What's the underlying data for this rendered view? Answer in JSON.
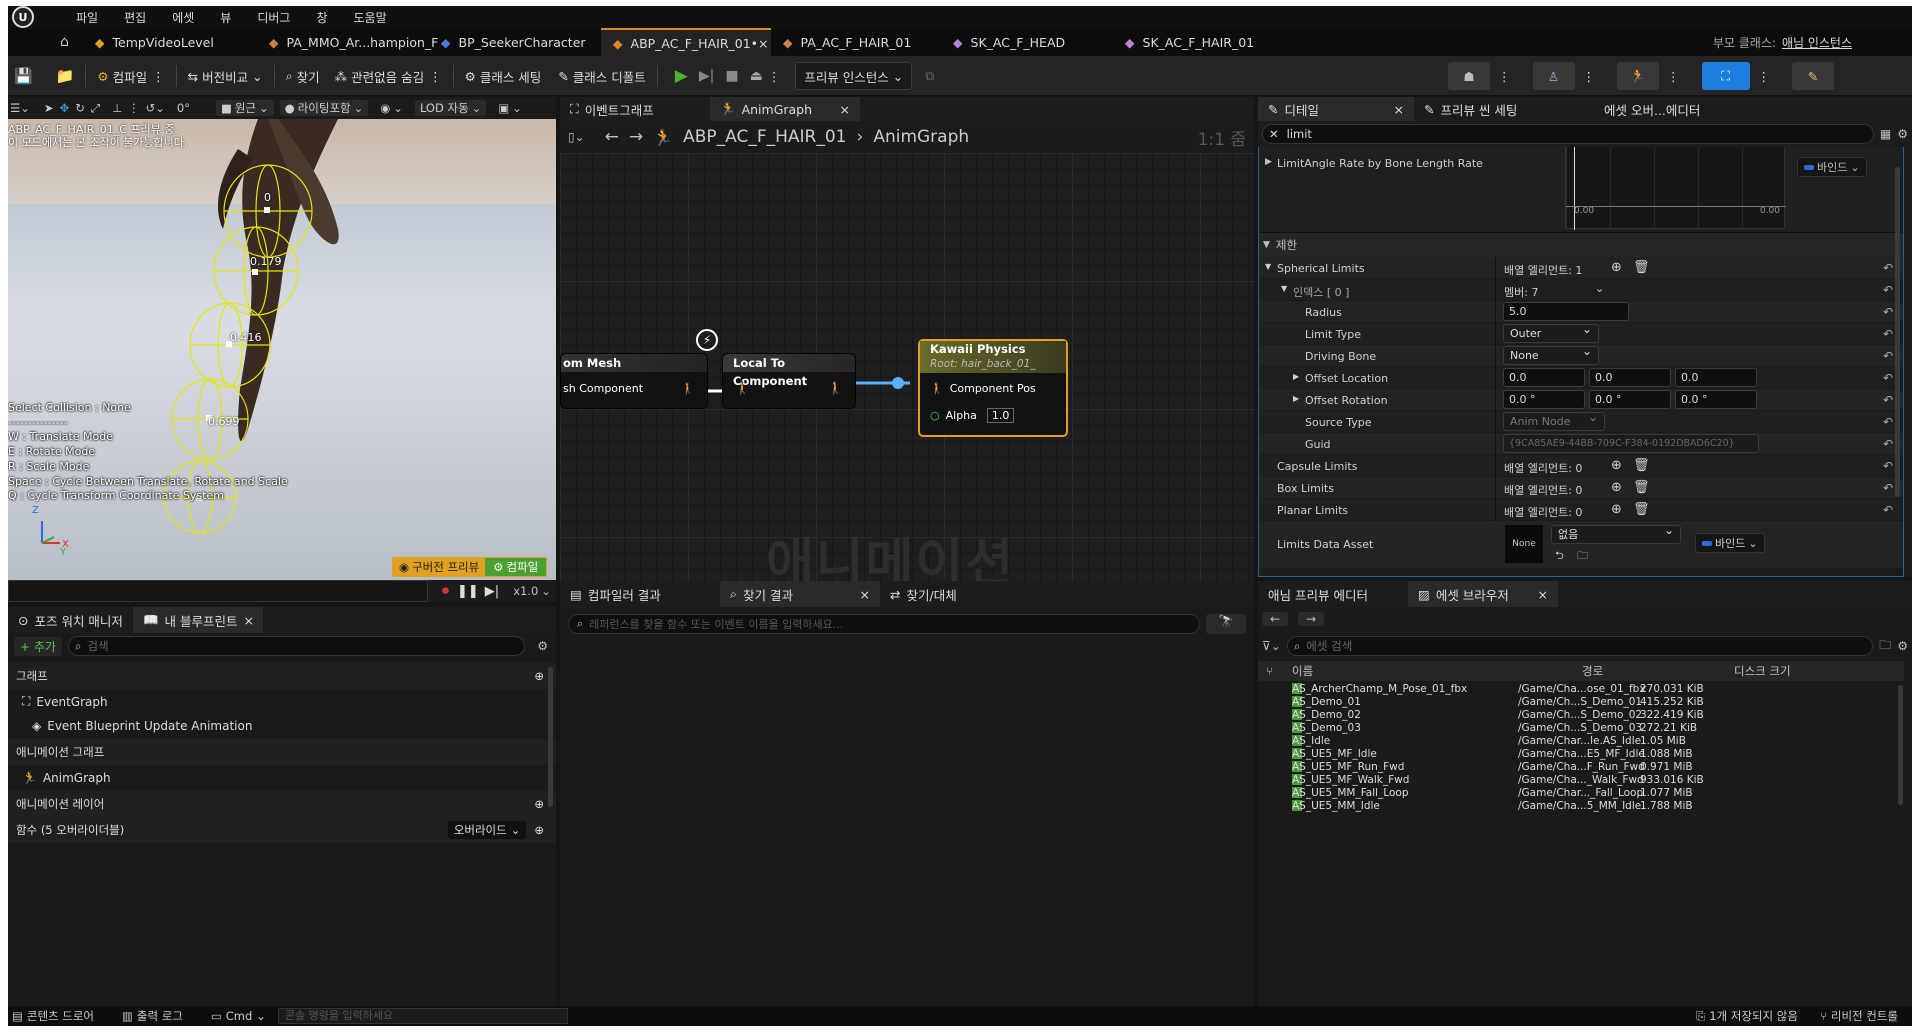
{
  "menu": [
    "파일",
    "편집",
    "에셋",
    "뷰",
    "디버그",
    "창",
    "도움말"
  ],
  "tabs": [
    {
      "label": "TempVideoLevel",
      "icon": "level-icon"
    },
    {
      "label": "PA_MMO_Ar...hampion_F",
      "icon": "physics-asset-icon"
    },
    {
      "label": "BP_SeekerCharacter",
      "icon": "blueprint-icon"
    },
    {
      "label": "ABP_AC_F_HAIR_01•",
      "icon": "anim-blueprint-icon",
      "active": true,
      "close": "×"
    },
    {
      "label": "PA_AC_F_HAIR_01",
      "icon": "physics-asset-icon"
    },
    {
      "label": "SK_AC_F_HEAD",
      "icon": "skeletal-mesh-icon"
    },
    {
      "label": "SK_AC_F_HAIR_01",
      "icon": "skeletal-mesh-icon"
    }
  ],
  "parent_class": {
    "label": "부모 클래스:",
    "value": "애님 인스턴스"
  },
  "toolbar": {
    "compile": "컴파일",
    "diff": "버전비교",
    "find": "찾기",
    "hide_unrelated": "관련없음 숨김",
    "class_settings": "클래스 세팅",
    "class_defaults": "클래스 디폴트",
    "preview_instance": "프리뷰 인스턴스"
  },
  "viewport": {
    "perspective": "원근",
    "lit": "라이팅포함",
    "lod": "LOD 자동",
    "rot_value": "0°",
    "notice_line1": "ABP_AC_F_HAIR_01_C 프리뷰 중.",
    "notice_line2": "이 모드에서는 본 조작이 불가능합니다.",
    "bone_labels": [
      "0",
      "0.179",
      "0.416",
      "0.699"
    ],
    "help": [
      "Select Collision : None",
      "---------------",
      "W : Translate Mode",
      "E : Rotate Mode",
      "R : Scale Mode",
      "Space : Cycle Between Translate, Rotate and Scale",
      "Q : Cycle Transform Coordinate System"
    ],
    "axis_z": "Z",
    "axis_x": "X",
    "axis_y": "Y",
    "old_preview_btn": "구버전 프리뷰",
    "compile_btn": "컴파일",
    "speed": "x1.0"
  },
  "graph": {
    "tabs": [
      "이벤트그래프",
      "AnimGraph"
    ],
    "close": "×",
    "breadcrumb_root": "ABP_AC_F_HAIR_01",
    "breadcrumb_leaf": "AnimGraph",
    "zoom": "1:1 줌",
    "watermark": "애니메이션",
    "node1": {
      "title": "om Mesh",
      "pin": "sh Component"
    },
    "node2": {
      "title": "Local To Component"
    },
    "node3": {
      "title": "Kawaii Physics",
      "subtitle": "Root: hair_back_01_",
      "pin1": "Component Pos",
      "pin2": "Alpha",
      "alpha": "1.0"
    }
  },
  "details": {
    "tabs": [
      "디테일",
      "프리뷰 씬 세팅",
      "에셋 오버...에디터"
    ],
    "close": "×",
    "search": "limit",
    "curve_label": "LimitAngle Rate by Bone Length Rate",
    "curve_ticks": [
      "0.00",
      "0.00"
    ],
    "bind": "바인드",
    "category": "제한",
    "spherical": {
      "label": "Spherical Limits",
      "value": "배열 엘리먼트: 1"
    },
    "index": {
      "label": "인덱스 [ 0 ]",
      "value": "멤버: 7"
    },
    "radius": {
      "label": "Radius",
      "value": "5.0"
    },
    "limit_type": {
      "label": "Limit Type",
      "value": "Outer"
    },
    "driving_bone": {
      "label": "Driving Bone",
      "value": "None"
    },
    "offset_location": {
      "label": "Offset Location",
      "x": "0.0",
      "y": "0.0",
      "z": "0.0"
    },
    "offset_rotation": {
      "label": "Offset Rotation",
      "x": "0.0 °",
      "y": "0.0 °",
      "z": "0.0 °"
    },
    "source_type": {
      "label": "Source Type",
      "value": "Anim Node"
    },
    "guid": {
      "label": "Guid",
      "value": "{9CA85AE9-44BB-709C-F384-0192DBAD6C20}"
    },
    "capsule": {
      "label": "Capsule Limits",
      "value": "배열 엘리먼트: 0"
    },
    "box": {
      "label": "Box Limits",
      "value": "배열 엘리먼트: 0"
    },
    "planar": {
      "label": "Planar Limits",
      "value": "배열 엘리먼트: 0"
    },
    "data_asset": {
      "label": "Limits Data Asset",
      "thumb": "None",
      "value": "없음"
    }
  },
  "left_bottom": {
    "tabs": [
      "포즈 워치 매니저",
      "내 블루프린트"
    ],
    "close": "×",
    "add": "+ 추가",
    "search": "검색",
    "graph_section": "그래프",
    "event_graph": "EventGraph",
    "event_update": "Event Blueprint Update Animation",
    "anim_graph_section": "애니메이션 그래프",
    "anim_graph": "AnimGraph",
    "anim_layer": "애니메이션 레이어",
    "functions": "함수 (5 오버라이더블)",
    "override": "오버라이드"
  },
  "compiler": {
    "tabs": [
      "컴파일러 결과",
      "찾기 결과",
      "찾기/대체"
    ],
    "close": "×",
    "search_placeholder": "레퍼런스를 찾을 함수 또는 이벤트 이름을 입력하세요..."
  },
  "asset_browser": {
    "tabs": [
      "애님 프리뷰 에디터",
      "에셋 브라우저"
    ],
    "close": "×",
    "search": "에셋 검색",
    "columns": [
      "이름",
      "경로",
      "디스크 크기"
    ],
    "rows": [
      [
        "AS_ArcherChamp_M_Pose_01_fbx",
        "/Game/Cha...ose_01_fbx",
        "270.031 KiB"
      ],
      [
        "AS_Demo_01",
        "/Game/Ch...S_Demo_01",
        "415.252 KiB"
      ],
      [
        "AS_Demo_02",
        "/Game/Ch...S_Demo_02",
        "322.419 KiB"
      ],
      [
        "AS_Demo_03",
        "/Game/Ch...S_Demo_03",
        "272.21 KiB"
      ],
      [
        "AS_Idle",
        "/Game/Char...le.AS_Idle",
        "1.05 MiB"
      ],
      [
        "AS_UE5_MF_Idle",
        "/Game/Cha...E5_MF_Idle",
        "1.088 MiB"
      ],
      [
        "AS_UE5_MF_Run_Fwd",
        "/Game/Cha...F_Run_Fwd",
        "0.971 MiB"
      ],
      [
        "AS_UE5_MF_Walk_Fwd",
        "/Game/Cha..._Walk_Fwd",
        "933.016 KiB"
      ],
      [
        "AS_UE5_MM_Fall_Loop",
        "/Game/Char..._Fall_Loop",
        "1.077 MiB"
      ],
      [
        "AS_UE5_MM_Idle",
        "/Game/Cha...5_MM_Idle",
        "1.788 MiB"
      ]
    ]
  },
  "status": {
    "content_drawer": "콘텐츠 드로어",
    "output_log": "출력 로그",
    "cmd": "Cmd",
    "cmd_placeholder": "콘솔 명령을 입력하세요",
    "unsaved": "1개 저장되지 않음",
    "revision": "리비전 컨트롤"
  }
}
